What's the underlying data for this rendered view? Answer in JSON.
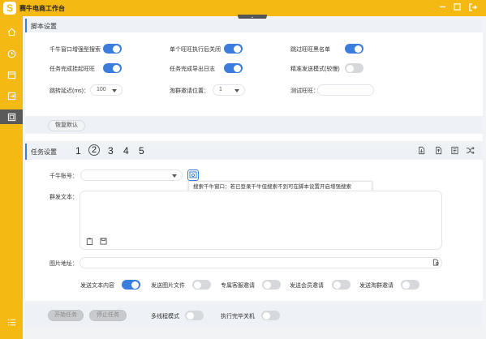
{
  "app": {
    "title": "赛牛电商工作台"
  },
  "window": {
    "controls": [
      "minus-icon",
      "square-icon",
      "exit-icon"
    ]
  },
  "sidebar": {
    "items": [
      {
        "icon": "home-icon"
      },
      {
        "icon": "clock-icon"
      },
      {
        "icon": "calendar-icon"
      },
      {
        "icon": "export-icon"
      },
      {
        "icon": "monitor-icon",
        "active": true
      }
    ],
    "bottom_icon": "list-icon"
  },
  "script_settings": {
    "title": "脚本设置",
    "toggles": [
      {
        "label": "千牛窗口增强型搜索",
        "on": true
      },
      {
        "label": "单个旺旺执行后关闭",
        "on": true
      },
      {
        "label": "跳过旺旺黑名单",
        "on": true
      },
      {
        "label": "任务完成挂起旺旺",
        "on": true
      },
      {
        "label": "任务完成导出日志",
        "on": true
      },
      {
        "label": "精准发送模式(较慢)",
        "on": false
      }
    ],
    "jump_delay": {
      "label": "跳转延迟(ms)：",
      "value": "100"
    },
    "invite_position": {
      "label": "淘群邀请位置：",
      "value": "1"
    },
    "test_wangwang": {
      "label": "测试旺旺：",
      "value": ""
    },
    "restore_button": "恢复默认"
  },
  "task_settings": {
    "title": "任务设置",
    "tabs": [
      "1",
      "2",
      "3",
      "4",
      "5"
    ],
    "selected_tab": "2",
    "tool_icons": [
      "import-icon",
      "export-file-icon",
      "document-icon",
      "shuffle-icon"
    ],
    "account": {
      "label": "千牛账号：",
      "value": ""
    },
    "tooltip": "搜索千牛窗口：若已登录千牛但搜索不到可在脚本设置开启增强搜索",
    "group_text": {
      "label": "群发文本：",
      "value": ""
    },
    "image_address": {
      "label": "图片地址：",
      "value": ""
    },
    "send_toggles": [
      {
        "label": "发送文本内容",
        "on": true
      },
      {
        "label": "发送图片文件",
        "on": false
      },
      {
        "label": "专属客服邀请",
        "on": false
      },
      {
        "label": "发送会员邀请",
        "on": false
      },
      {
        "label": "发送淘群邀请",
        "on": false
      }
    ]
  },
  "bottom": {
    "start_button": "开始任务",
    "stop_button": "停止任务",
    "multithread": {
      "label": "多线程模式",
      "on": false
    },
    "shutdown": {
      "label": "执行完毕关机",
      "on": false
    }
  },
  "colors": {
    "accent": "#3b7ddd",
    "brand": "#f5b914",
    "sidebar_active": "#5a5a5a"
  }
}
